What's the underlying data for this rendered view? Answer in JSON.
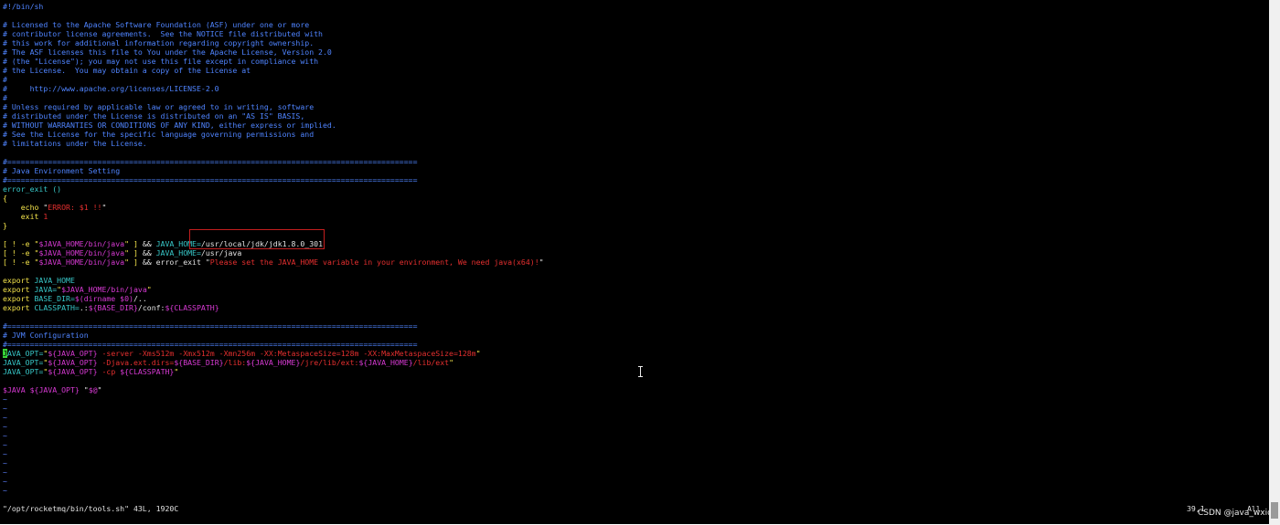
{
  "editor": {
    "lines": [
      [
        {
          "t": "#!/bin/sh",
          "c": "cm"
        }
      ],
      [],
      [
        {
          "t": "# Licensed to the Apache Software Foundation (ASF) under one or more",
          "c": "cm"
        }
      ],
      [
        {
          "t": "# contributor license agreements.  See the NOTICE file distributed with",
          "c": "cm"
        }
      ],
      [
        {
          "t": "# this work for additional information regarding copyright ownership.",
          "c": "cm"
        }
      ],
      [
        {
          "t": "# The ASF licenses this file to You under the Apache License, Version 2.0",
          "c": "cm"
        }
      ],
      [
        {
          "t": "# (the \"License\"); you may not use this file except in compliance with",
          "c": "cm"
        }
      ],
      [
        {
          "t": "# the License.  You may obtain a copy of the License at",
          "c": "cm"
        }
      ],
      [
        {
          "t": "#",
          "c": "cm"
        }
      ],
      [
        {
          "t": "#     http://www.apache.org/licenses/LICENSE-2.0",
          "c": "cm"
        }
      ],
      [
        {
          "t": "#",
          "c": "cm"
        }
      ],
      [
        {
          "t": "# Unless required by applicable law or agreed to in writing, software",
          "c": "cm"
        }
      ],
      [
        {
          "t": "# distributed under the License is distributed on an \"AS IS\" BASIS,",
          "c": "cm"
        }
      ],
      [
        {
          "t": "# WITHOUT WARRANTIES OR CONDITIONS OF ANY KIND, either express or implied.",
          "c": "cm"
        }
      ],
      [
        {
          "t": "# See the License for the specific language governing permissions and",
          "c": "cm"
        }
      ],
      [
        {
          "t": "# limitations under the License.",
          "c": "cm"
        }
      ],
      [],
      [
        {
          "t": "#===========================================================================================",
          "c": "cm"
        }
      ],
      [
        {
          "t": "# Java Environment Setting",
          "c": "cm"
        }
      ],
      [
        {
          "t": "#===========================================================================================",
          "c": "cm"
        }
      ],
      [
        {
          "t": "error_exit ()",
          "c": "cy"
        }
      ],
      [
        {
          "t": "{",
          "c": "yl"
        }
      ],
      [
        {
          "t": "    ",
          "c": "wh"
        },
        {
          "t": "echo",
          "c": "yl"
        },
        {
          "t": " \"",
          "c": "wh"
        },
        {
          "t": "ERROR: $1 !!",
          "c": "rd"
        },
        {
          "t": "\"",
          "c": "wh"
        }
      ],
      [
        {
          "t": "    ",
          "c": "wh"
        },
        {
          "t": "exit",
          "c": "yl"
        },
        {
          "t": " ",
          "c": "wh"
        },
        {
          "t": "1",
          "c": "rd"
        }
      ],
      [
        {
          "t": "}",
          "c": "yl"
        }
      ],
      [],
      [
        {
          "t": "[ ! -e \"",
          "c": "yl"
        },
        {
          "t": "$JAVA_HOME/bin/java",
          "c": "mg"
        },
        {
          "t": "\" ] ",
          "c": "yl"
        },
        {
          "t": "&& ",
          "c": "wh"
        },
        {
          "t": "JAVA_HOME=",
          "c": "cy"
        },
        {
          "t": "/usr/local/jdk/jdk1.8.0_301",
          "c": "wh"
        }
      ],
      [
        {
          "t": "[ ! -e \"",
          "c": "yl"
        },
        {
          "t": "$JAVA_HOME/bin/java",
          "c": "mg"
        },
        {
          "t": "\" ] ",
          "c": "yl"
        },
        {
          "t": "&& ",
          "c": "wh"
        },
        {
          "t": "JAVA_HOME=",
          "c": "cy"
        },
        {
          "t": "/usr/java",
          "c": "wh"
        }
      ],
      [
        {
          "t": "[ ! -e \"",
          "c": "yl"
        },
        {
          "t": "$JAVA_HOME/bin/java",
          "c": "mg"
        },
        {
          "t": "\" ] ",
          "c": "yl"
        },
        {
          "t": "&& error_exit \"",
          "c": "wh"
        },
        {
          "t": "Please set the JAVA_HOME variable in your environment, We need java(x64)!",
          "c": "rd"
        },
        {
          "t": "\"",
          "c": "wh"
        }
      ],
      [],
      [
        {
          "t": "export",
          "c": "yl"
        },
        {
          "t": " JAVA_HOME",
          "c": "cy"
        }
      ],
      [
        {
          "t": "export",
          "c": "yl"
        },
        {
          "t": " JAVA=",
          "c": "cy"
        },
        {
          "t": "\"",
          "c": "yl"
        },
        {
          "t": "$JAVA_HOME/bin/java",
          "c": "mg"
        },
        {
          "t": "\"",
          "c": "yl"
        }
      ],
      [
        {
          "t": "export",
          "c": "yl"
        },
        {
          "t": " BASE_DIR=",
          "c": "cy"
        },
        {
          "t": "$(dirname $0)",
          "c": "mg"
        },
        {
          "t": "/..",
          "c": "wh"
        }
      ],
      [
        {
          "t": "export",
          "c": "yl"
        },
        {
          "t": " CLASSPATH=",
          "c": "cy"
        },
        {
          "t": ".:",
          "c": "wh"
        },
        {
          "t": "${BASE_DIR}",
          "c": "mg"
        },
        {
          "t": "/conf:",
          "c": "wh"
        },
        {
          "t": "${CLASSPATH}",
          "c": "mg"
        }
      ],
      [],
      [
        {
          "t": "#===========================================================================================",
          "c": "cm"
        }
      ],
      [
        {
          "t": "# JVM Configuration",
          "c": "cm"
        }
      ],
      [
        {
          "t": "#===========================================================================================",
          "c": "cm"
        }
      ],
      [
        {
          "t": "J",
          "c": "cursor"
        },
        {
          "t": "AVA_OPT=",
          "c": "cy"
        },
        {
          "t": "\"",
          "c": "yl"
        },
        {
          "t": "${JAVA_OPT}",
          "c": "mg"
        },
        {
          "t": " -server -Xms512m -Xmx512m -Xmn256m -XX:MetaspaceSize=128m -XX:MaxMetaspaceSize=128m",
          "c": "rd"
        },
        {
          "t": "\"",
          "c": "yl"
        }
      ],
      [
        {
          "t": "JAVA_OPT=",
          "c": "cy"
        },
        {
          "t": "\"",
          "c": "yl"
        },
        {
          "t": "${JAVA_OPT}",
          "c": "mg"
        },
        {
          "t": " -Djava.ext.dirs=",
          "c": "rd"
        },
        {
          "t": "${BASE_DIR}",
          "c": "mg"
        },
        {
          "t": "/lib:",
          "c": "rd"
        },
        {
          "t": "${JAVA_HOME}",
          "c": "mg"
        },
        {
          "t": "/jre/lib/ext:",
          "c": "rd"
        },
        {
          "t": "${JAVA_HOME}",
          "c": "mg"
        },
        {
          "t": "/lib/ext",
          "c": "rd"
        },
        {
          "t": "\"",
          "c": "yl"
        }
      ],
      [
        {
          "t": "JAVA_OPT=",
          "c": "cy"
        },
        {
          "t": "\"",
          "c": "yl"
        },
        {
          "t": "${JAVA_OPT}",
          "c": "mg"
        },
        {
          "t": " -cp ",
          "c": "rd"
        },
        {
          "t": "${CLASSPATH}",
          "c": "mg"
        },
        {
          "t": "\"",
          "c": "yl"
        }
      ],
      [],
      [
        {
          "t": "$JAVA",
          "c": "mg"
        },
        {
          "t": " ",
          "c": "wh"
        },
        {
          "t": "${JAVA_OPT}",
          "c": "mg"
        },
        {
          "t": " \"",
          "c": "wh"
        },
        {
          "t": "$@",
          "c": "mg"
        },
        {
          "t": "\"",
          "c": "wh"
        }
      ],
      [
        {
          "t": "~",
          "c": "tl"
        }
      ],
      [
        {
          "t": "~",
          "c": "tl"
        }
      ],
      [
        {
          "t": "~",
          "c": "tl"
        }
      ],
      [
        {
          "t": "~",
          "c": "tl"
        }
      ],
      [
        {
          "t": "~",
          "c": "tl"
        }
      ],
      [
        {
          "t": "~",
          "c": "tl"
        }
      ],
      [
        {
          "t": "~",
          "c": "tl"
        }
      ],
      [
        {
          "t": "~",
          "c": "tl"
        }
      ],
      [
        {
          "t": "~",
          "c": "tl"
        }
      ],
      [
        {
          "t": "~",
          "c": "tl"
        }
      ],
      [
        {
          "t": "~",
          "c": "tl"
        }
      ]
    ]
  },
  "status": {
    "file": "\"/opt/rocketmq/bin/tools.sh\" 43L, 1920C",
    "position": "39,1",
    "scroll": "All"
  },
  "watermark": "CSDN @java_wxid",
  "colors": {
    "background": "#000000",
    "comment": "#4f84ff",
    "keyword": "#f2e24a",
    "identifier": "#38c9ca",
    "string": "#e52f2f",
    "variable": "#d83ad4",
    "cursor": "#38d438",
    "highlight_box": "#c41e1e"
  }
}
